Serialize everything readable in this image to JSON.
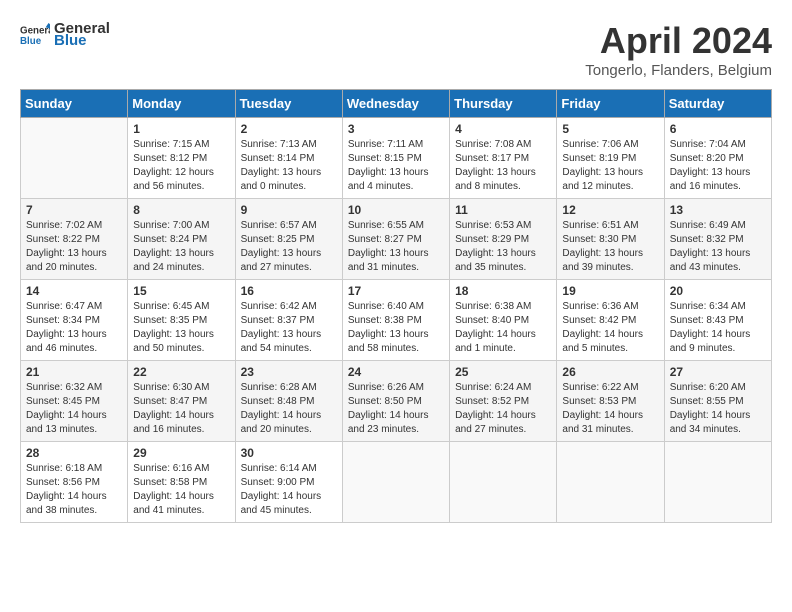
{
  "header": {
    "logo_line1": "General",
    "logo_line2": "Blue",
    "month_year": "April 2024",
    "location": "Tongerlo, Flanders, Belgium"
  },
  "days_of_week": [
    "Sunday",
    "Monday",
    "Tuesday",
    "Wednesday",
    "Thursday",
    "Friday",
    "Saturday"
  ],
  "weeks": [
    [
      {
        "day": "",
        "content": ""
      },
      {
        "day": "1",
        "content": "Sunrise: 7:15 AM\nSunset: 8:12 PM\nDaylight: 12 hours\nand 56 minutes."
      },
      {
        "day": "2",
        "content": "Sunrise: 7:13 AM\nSunset: 8:14 PM\nDaylight: 13 hours\nand 0 minutes."
      },
      {
        "day": "3",
        "content": "Sunrise: 7:11 AM\nSunset: 8:15 PM\nDaylight: 13 hours\nand 4 minutes."
      },
      {
        "day": "4",
        "content": "Sunrise: 7:08 AM\nSunset: 8:17 PM\nDaylight: 13 hours\nand 8 minutes."
      },
      {
        "day": "5",
        "content": "Sunrise: 7:06 AM\nSunset: 8:19 PM\nDaylight: 13 hours\nand 12 minutes."
      },
      {
        "day": "6",
        "content": "Sunrise: 7:04 AM\nSunset: 8:20 PM\nDaylight: 13 hours\nand 16 minutes."
      }
    ],
    [
      {
        "day": "7",
        "content": "Sunrise: 7:02 AM\nSunset: 8:22 PM\nDaylight: 13 hours\nand 20 minutes."
      },
      {
        "day": "8",
        "content": "Sunrise: 7:00 AM\nSunset: 8:24 PM\nDaylight: 13 hours\nand 24 minutes."
      },
      {
        "day": "9",
        "content": "Sunrise: 6:57 AM\nSunset: 8:25 PM\nDaylight: 13 hours\nand 27 minutes."
      },
      {
        "day": "10",
        "content": "Sunrise: 6:55 AM\nSunset: 8:27 PM\nDaylight: 13 hours\nand 31 minutes."
      },
      {
        "day": "11",
        "content": "Sunrise: 6:53 AM\nSunset: 8:29 PM\nDaylight: 13 hours\nand 35 minutes."
      },
      {
        "day": "12",
        "content": "Sunrise: 6:51 AM\nSunset: 8:30 PM\nDaylight: 13 hours\nand 39 minutes."
      },
      {
        "day": "13",
        "content": "Sunrise: 6:49 AM\nSunset: 8:32 PM\nDaylight: 13 hours\nand 43 minutes."
      }
    ],
    [
      {
        "day": "14",
        "content": "Sunrise: 6:47 AM\nSunset: 8:34 PM\nDaylight: 13 hours\nand 46 minutes."
      },
      {
        "day": "15",
        "content": "Sunrise: 6:45 AM\nSunset: 8:35 PM\nDaylight: 13 hours\nand 50 minutes."
      },
      {
        "day": "16",
        "content": "Sunrise: 6:42 AM\nSunset: 8:37 PM\nDaylight: 13 hours\nand 54 minutes."
      },
      {
        "day": "17",
        "content": "Sunrise: 6:40 AM\nSunset: 8:38 PM\nDaylight: 13 hours\nand 58 minutes."
      },
      {
        "day": "18",
        "content": "Sunrise: 6:38 AM\nSunset: 8:40 PM\nDaylight: 14 hours\nand 1 minute."
      },
      {
        "day": "19",
        "content": "Sunrise: 6:36 AM\nSunset: 8:42 PM\nDaylight: 14 hours\nand 5 minutes."
      },
      {
        "day": "20",
        "content": "Sunrise: 6:34 AM\nSunset: 8:43 PM\nDaylight: 14 hours\nand 9 minutes."
      }
    ],
    [
      {
        "day": "21",
        "content": "Sunrise: 6:32 AM\nSunset: 8:45 PM\nDaylight: 14 hours\nand 13 minutes."
      },
      {
        "day": "22",
        "content": "Sunrise: 6:30 AM\nSunset: 8:47 PM\nDaylight: 14 hours\nand 16 minutes."
      },
      {
        "day": "23",
        "content": "Sunrise: 6:28 AM\nSunset: 8:48 PM\nDaylight: 14 hours\nand 20 minutes."
      },
      {
        "day": "24",
        "content": "Sunrise: 6:26 AM\nSunset: 8:50 PM\nDaylight: 14 hours\nand 23 minutes."
      },
      {
        "day": "25",
        "content": "Sunrise: 6:24 AM\nSunset: 8:52 PM\nDaylight: 14 hours\nand 27 minutes."
      },
      {
        "day": "26",
        "content": "Sunrise: 6:22 AM\nSunset: 8:53 PM\nDaylight: 14 hours\nand 31 minutes."
      },
      {
        "day": "27",
        "content": "Sunrise: 6:20 AM\nSunset: 8:55 PM\nDaylight: 14 hours\nand 34 minutes."
      }
    ],
    [
      {
        "day": "28",
        "content": "Sunrise: 6:18 AM\nSunset: 8:56 PM\nDaylight: 14 hours\nand 38 minutes."
      },
      {
        "day": "29",
        "content": "Sunrise: 6:16 AM\nSunset: 8:58 PM\nDaylight: 14 hours\nand 41 minutes."
      },
      {
        "day": "30",
        "content": "Sunrise: 6:14 AM\nSunset: 9:00 PM\nDaylight: 14 hours\nand 45 minutes."
      },
      {
        "day": "",
        "content": ""
      },
      {
        "day": "",
        "content": ""
      },
      {
        "day": "",
        "content": ""
      },
      {
        "day": "",
        "content": ""
      }
    ]
  ]
}
